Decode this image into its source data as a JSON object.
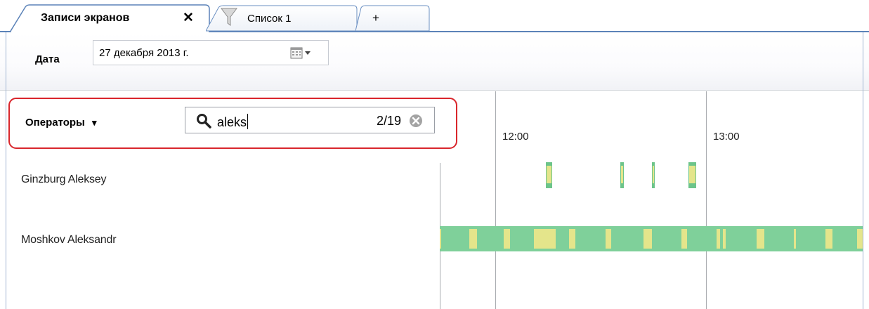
{
  "tabs": [
    {
      "label": "Записи экранов",
      "close_glyph": "✕",
      "active": true
    },
    {
      "label": "Список 1",
      "icon": "funnel-icon",
      "active": false
    },
    {
      "label": "+",
      "active": false
    }
  ],
  "toolbar": {
    "date_label": "Дата",
    "date_value": "27 декабря  2013 г.",
    "calendar_icon": "calendar-dropdown-icon"
  },
  "filter": {
    "operators_label": "Операторы",
    "dropdown_glyph": "▾",
    "search_value": "aleks",
    "match_count": "2/19",
    "highlight_color": "#d9262c"
  },
  "timeline": {
    "hours": [
      "12:00",
      "13:00"
    ],
    "operators": [
      {
        "name": "Ginzburg Aleksey"
      },
      {
        "name": "Moshkov Aleksandr"
      }
    ],
    "colors": {
      "active": "#7fd09a",
      "activity": "#e4e58b",
      "border": "#6cc48a"
    }
  }
}
